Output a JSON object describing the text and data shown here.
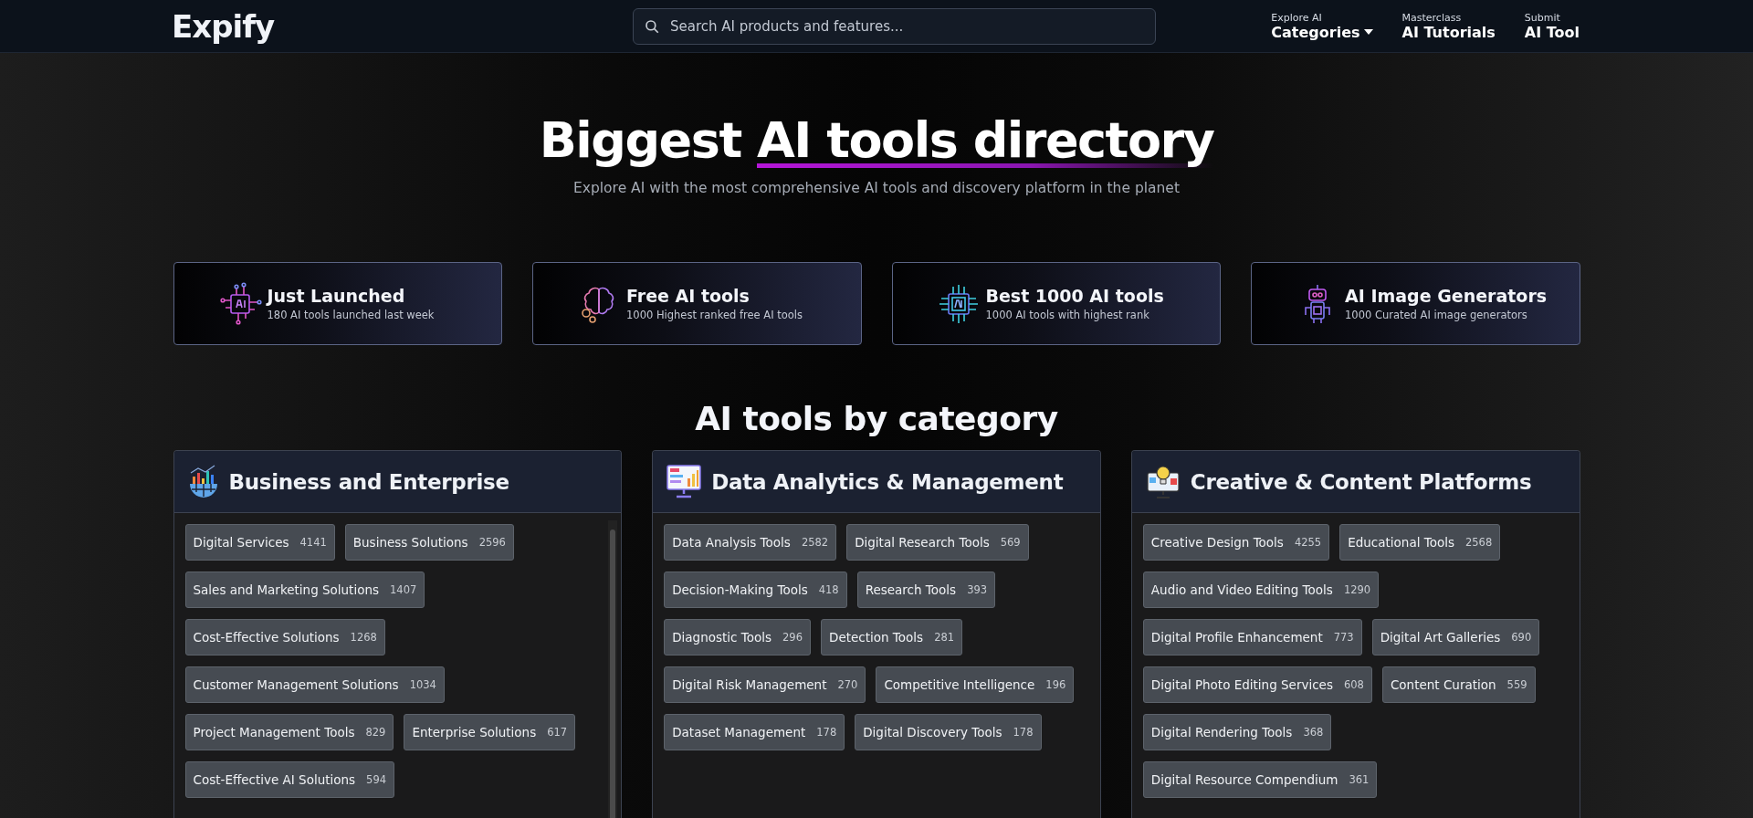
{
  "header": {
    "logo": "Expify",
    "search": {
      "placeholder": "Search AI products and features..."
    },
    "nav": [
      {
        "caption": "Explore AI",
        "label": "Categories",
        "dropdown": true
      },
      {
        "caption": "Masterclass",
        "label": "AI Tutorials",
        "dropdown": false
      },
      {
        "caption": "Submit",
        "label": "AI Tool",
        "dropdown": false
      }
    ]
  },
  "hero": {
    "title_lead": "Biggest",
    "title_highlight": "AI tools directory",
    "subtitle": "Explore AI with the most comprehensive AI tools and discovery platform in the planet"
  },
  "features": [
    {
      "kind": "chip",
      "title": "Just Launched",
      "subtitle": "180 AI tools launched last week"
    },
    {
      "kind": "brain",
      "title": "Free AI tools",
      "subtitle": "1000 Highest ranked free AI tools"
    },
    {
      "kind": "processor",
      "title": "Best 1000 AI tools",
      "subtitle": "1000 AI tools with highest rank"
    },
    {
      "kind": "robot",
      "title": "AI Image Generators",
      "subtitle": "1000 Curated AI image generators"
    }
  ],
  "categories_heading": "AI tools by category",
  "categories": [
    {
      "kind": "business",
      "title": "Business and Enterprise",
      "scrollbar": true,
      "tools": [
        {
          "name": "Digital Services",
          "count": "4141"
        },
        {
          "name": "Business Solutions",
          "count": "2596"
        },
        {
          "name": "Sales and Marketing Solutions",
          "count": "1407"
        },
        {
          "name": "Cost-Effective Solutions",
          "count": "1268"
        },
        {
          "name": "Customer Management Solutions",
          "count": "1034"
        },
        {
          "name": "Project Management Tools",
          "count": "829"
        },
        {
          "name": "Enterprise Solutions",
          "count": "617"
        },
        {
          "name": "Cost-Effective AI Solutions",
          "count": "594"
        }
      ]
    },
    {
      "kind": "analytics",
      "title": "Data Analytics & Management",
      "scrollbar": false,
      "tools": [
        {
          "name": "Data Analysis Tools",
          "count": "2582"
        },
        {
          "name": "Digital Research Tools",
          "count": "569"
        },
        {
          "name": "Decision-Making Tools",
          "count": "418"
        },
        {
          "name": "Research Tools",
          "count": "393"
        },
        {
          "name": "Diagnostic Tools",
          "count": "296"
        },
        {
          "name": "Detection Tools",
          "count": "281"
        },
        {
          "name": "Digital Risk Management",
          "count": "270"
        },
        {
          "name": "Competitive Intelligence",
          "count": "196"
        },
        {
          "name": "Dataset Management",
          "count": "178"
        },
        {
          "name": "Digital Discovery Tools",
          "count": "178"
        }
      ]
    },
    {
      "kind": "creative",
      "title": "Creative & Content Platforms",
      "scrollbar": false,
      "tools": [
        {
          "name": "Creative Design Tools",
          "count": "4255"
        },
        {
          "name": "Educational Tools",
          "count": "2568"
        },
        {
          "name": "Audio and Video Editing Tools",
          "count": "1290"
        },
        {
          "name": "Digital Profile Enhancement",
          "count": "773"
        },
        {
          "name": "Digital Art Galleries",
          "count": "690"
        },
        {
          "name": "Digital Photo Editing Services",
          "count": "608"
        },
        {
          "name": "Content Curation",
          "count": "559"
        },
        {
          "name": "Digital Rendering Tools",
          "count": "368"
        },
        {
          "name": "Digital Resource Compendium",
          "count": "361"
        }
      ]
    }
  ]
}
